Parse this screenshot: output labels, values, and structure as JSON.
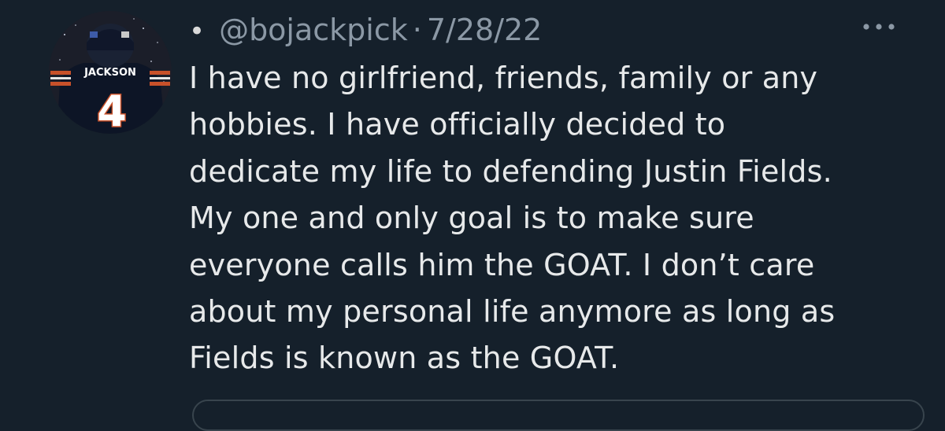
{
  "tweet": {
    "handle": "@bojackpick",
    "separator": "·",
    "date": "7/28/22",
    "bullet": "•",
    "lines": [
      "I have no girlfriend, friends, family or any",
      "hobbies. I have officially decided to",
      "dedicate my life to defending Justin Fields.",
      "My one and only goal is to make sure",
      "everyone calls him the GOAT. I don’t care",
      "about my personal life anymore as long as",
      "Fields is known as the GOAT."
    ]
  },
  "avatar": {
    "jersey_name": "JACKSON",
    "jersey_number": "4"
  },
  "icons": {
    "more": "more-horizontal-icon"
  },
  "colors": {
    "background": "#15202b",
    "text": "#e7e9ea",
    "secondary": "#8b98a5",
    "jersey_orange": "#c8512a"
  }
}
